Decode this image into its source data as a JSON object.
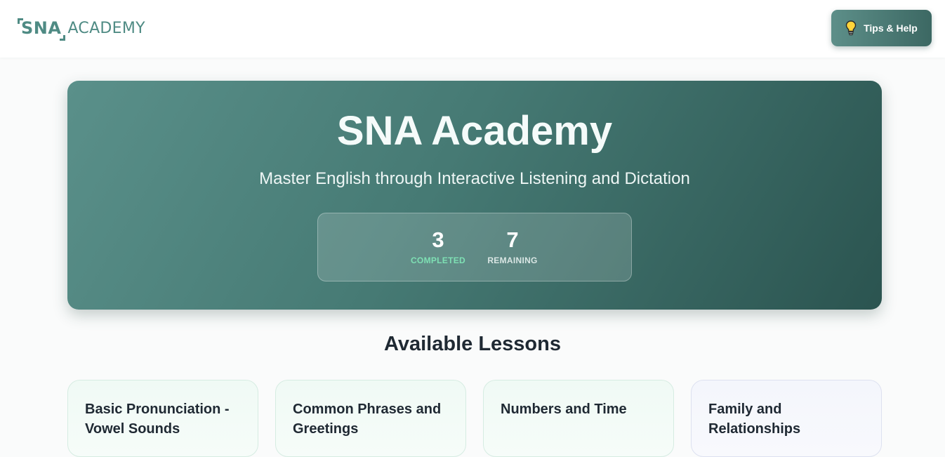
{
  "header": {
    "logo_mark": "SNA",
    "logo_word": "ACADEMY",
    "help_label": "Tips & Help"
  },
  "hero": {
    "title": "SNA Academy",
    "subtitle": "Master English through Interactive Listening and Dictation",
    "stats": [
      {
        "value": "3",
        "label": "COMPLETED"
      },
      {
        "value": "7",
        "label": "REMAINING"
      }
    ]
  },
  "lessons": {
    "heading": "Available Lessons",
    "items": [
      {
        "title": "Basic Pronunciation - Vowel Sounds"
      },
      {
        "title": "Common Phrases and Greetings"
      },
      {
        "title": "Numbers and Time"
      },
      {
        "title": "Family and Relationships"
      }
    ]
  },
  "colors": {
    "brand": "#4f8b84",
    "hero_dark": "#2b5450",
    "completed_accent": "#7ee0b4"
  },
  "icons": {
    "help": "lightbulb-icon"
  }
}
